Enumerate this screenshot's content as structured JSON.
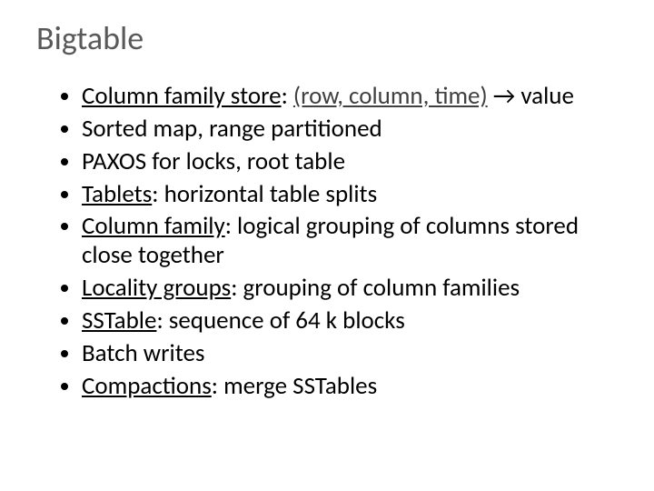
{
  "title": "Bigtable",
  "bullets": [
    {
      "lead_u": "Column family store",
      "after_lead": ": ",
      "tuple": "(row, column, time)",
      "tail": " → value"
    },
    {
      "text": "Sorted map, range partitioned"
    },
    {
      "text": "PAXOS for locks, root table"
    },
    {
      "lead_u": "Tablets",
      "tail": ": horizontal table splits"
    },
    {
      "lead_u": "Column family",
      "tail": ": logical grouping of columns stored close together"
    },
    {
      "lead_u": "Locality groups",
      "tail": ": grouping of column families"
    },
    {
      "lead_u": "SSTable",
      "tail": ": sequence of 64 k blocks"
    },
    {
      "text": "Batch writes"
    },
    {
      "lead_u": "Compactions",
      "tail": ": merge SSTables"
    }
  ]
}
